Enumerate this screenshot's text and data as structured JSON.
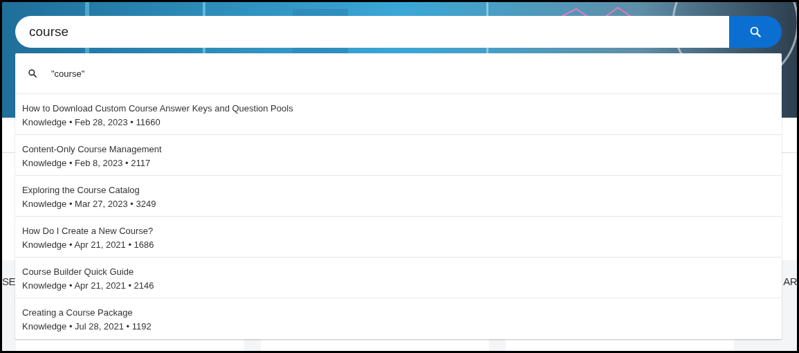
{
  "search": {
    "value": "course"
  },
  "suggestion": {
    "text": "\"course\""
  },
  "results": [
    {
      "title": "How to Download Custom Course Answer Keys and Question Pools",
      "meta": "Knowledge • Feb 28, 2023 • 11660"
    },
    {
      "title": "Content-Only Course Management",
      "meta": "Knowledge • Feb 8, 2023 • 2117"
    },
    {
      "title": "Exploring the Course Catalog",
      "meta": "Knowledge • Mar 27, 2023 • 3249"
    },
    {
      "title": "How Do I Create a New Course?",
      "meta": "Knowledge • Apr 21, 2021 • 1686"
    },
    {
      "title": "Course Builder Quick Guide",
      "meta": "Knowledge • Apr 21, 2021 • 2146"
    },
    {
      "title": "Creating a Course Package",
      "meta": "Knowledge • Jul 28, 2021 • 1192"
    }
  ],
  "section_headings": [
    "SE",
    "AR"
  ]
}
